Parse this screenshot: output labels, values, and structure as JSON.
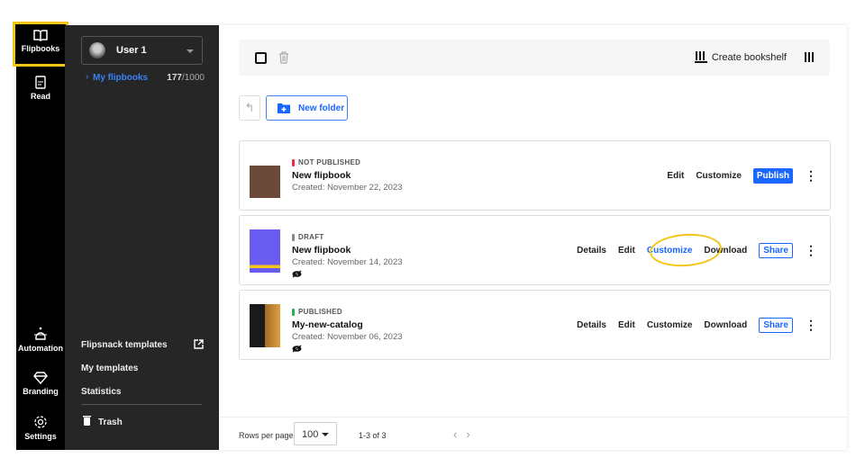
{
  "rail": {
    "items": [
      {
        "label": "Flipbooks",
        "icon": "book-open-icon"
      },
      {
        "label": "Read",
        "icon": "document-icon"
      },
      {
        "label": "Automation",
        "icon": "robot-icon"
      },
      {
        "label": "Branding",
        "icon": "diamond-icon"
      },
      {
        "label": "Settings",
        "icon": "gear-icon"
      }
    ]
  },
  "panel": {
    "user": "User 1",
    "my_flipbooks": "My flipbooks",
    "count_used": "177",
    "count_total": "/1000",
    "links": [
      "Flipsnack templates",
      "My templates",
      "Statistics"
    ],
    "trash": "Trash"
  },
  "toolbar": {
    "create_bookshelf": "Create bookshelf"
  },
  "new_folder": "New folder",
  "items": [
    {
      "status": "NOT PUBLISHED",
      "status_color": "#f0284a",
      "title": "New flipbook",
      "created": "Created: November 22, 2023",
      "actions": [
        "Edit",
        "Customize"
      ],
      "primary": "Publish"
    },
    {
      "status": "DRAFT",
      "status_color": "#888888",
      "title": "New flipbook",
      "created": "Created: November 14, 2023",
      "actions": [
        "Details",
        "Edit",
        "Customize",
        "Download"
      ],
      "primary": "Share"
    },
    {
      "status": "PUBLISHED",
      "status_color": "#22b34a",
      "title": "My-new-catalog",
      "created": "Created: November 06, 2023",
      "actions": [
        "Details",
        "Edit",
        "Customize",
        "Download"
      ],
      "primary": "Share"
    }
  ],
  "pagination": {
    "rows_per_page_label": "Rows per page",
    "rows_per_page": "100",
    "range": "1-3 of 3"
  },
  "colors": {
    "accent": "#1a66ff",
    "highlight": "#f5c518"
  }
}
